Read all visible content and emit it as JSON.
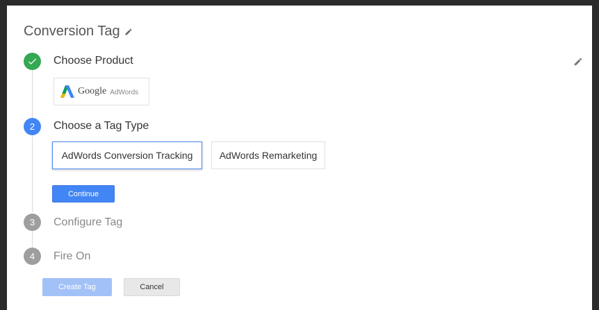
{
  "title": "Conversion Tag",
  "colors": {
    "done": "#34a853",
    "active": "#4285f4",
    "pending": "#9e9e9e"
  },
  "steps": [
    {
      "label": "Choose Product",
      "state": "done",
      "icon": "check-icon"
    },
    {
      "number": "2",
      "label": "Choose a Tag Type",
      "state": "active"
    },
    {
      "number": "3",
      "label": "Configure Tag",
      "state": "pending"
    },
    {
      "number": "4",
      "label": "Fire On",
      "state": "pending"
    }
  ],
  "product": {
    "logo_text": "Google",
    "logo_sub": "AdWords"
  },
  "tag_types": [
    {
      "label": "AdWords Conversion Tracking",
      "selected": true
    },
    {
      "label": "AdWords Remarketing",
      "selected": false
    }
  ],
  "buttons": {
    "continue": "Continue",
    "create": "Create Tag",
    "cancel": "Cancel"
  }
}
